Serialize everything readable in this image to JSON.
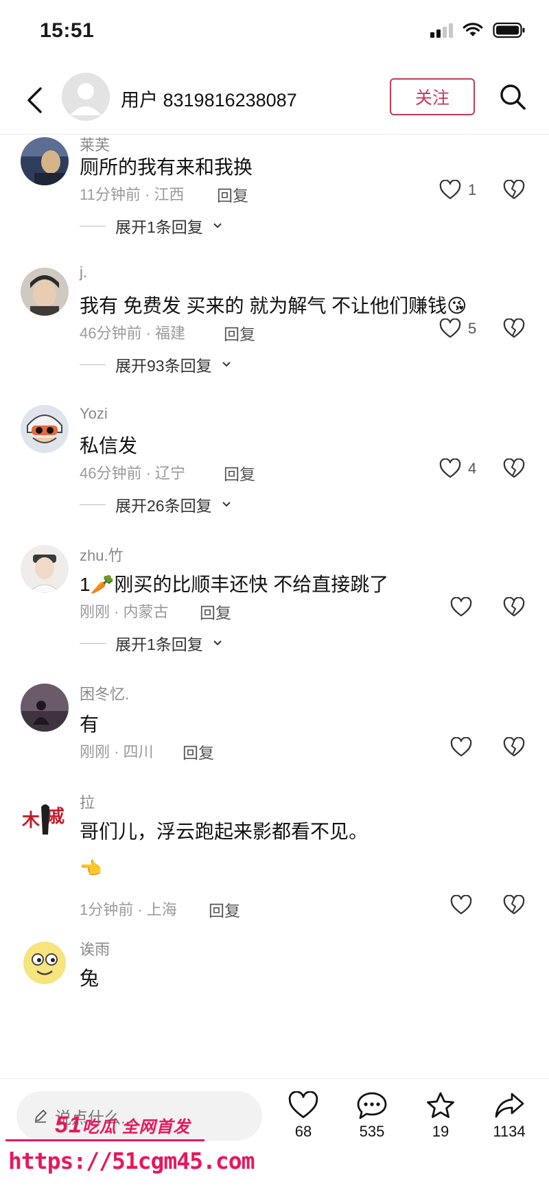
{
  "status_bar": {
    "time": "15:51"
  },
  "header": {
    "username": "用户 8319816238087",
    "follow_label": "关注"
  },
  "comments": [
    {
      "user": "莱芙",
      "text": "厕所的我有来和我换",
      "meta": "11分钟前 · 江西",
      "reply": "回复",
      "likes": "1",
      "expand": "展开1条回复",
      "avatar_color": "#3b4a66"
    },
    {
      "user": "j.",
      "text": "我有 免费发 买来的 就为解气 不让他们赚钱😘",
      "meta": "46分钟前 · 福建",
      "reply": "回复",
      "likes": "5",
      "expand": "展开93条回复",
      "avatar_color": "#b9b1a6"
    },
    {
      "user": "Yozi",
      "text": "私信发",
      "meta": "46分钟前 · 辽宁",
      "reply": "回复",
      "likes": "4",
      "expand": "展开26条回复",
      "avatar_color": "#c9cfd8"
    },
    {
      "user": "zhu.竹",
      "text": "1🥕刚买的比顺丰还快 不给直接跳了",
      "meta": "刚刚 · 内蒙古",
      "reply": "回复",
      "likes": "",
      "expand": "展开1条回复",
      "avatar_color": "#e3dcd8"
    },
    {
      "user": "困冬忆.",
      "text": "有",
      "meta": "刚刚 · 四川",
      "reply": "回复",
      "likes": "",
      "expand": "",
      "avatar_color": "#4c4250"
    },
    {
      "user": "拉",
      "text": "哥们儿，浮云跑起来影都看不见。",
      "text2": "👈",
      "meta": "1分钟前 · 上海",
      "reply": "回复",
      "likes": "",
      "expand": "",
      "avatar_color": "#ffffff"
    },
    {
      "user": "诶雨",
      "text": "兔",
      "meta": "",
      "reply": "",
      "likes": "",
      "expand": "",
      "avatar_color": "#f6e27a"
    }
  ],
  "bottom_bar": {
    "input_placeholder": "说点什么...",
    "likes": "68",
    "comments": "535",
    "favorites": "19",
    "shares": "1134"
  },
  "watermark": {
    "logo_number": "51",
    "logo_text": "吃瓜 全网首发",
    "url": "https://51cgm45.com"
  },
  "colors": {
    "accent": "#c63957",
    "watermark": "#e8175d"
  }
}
